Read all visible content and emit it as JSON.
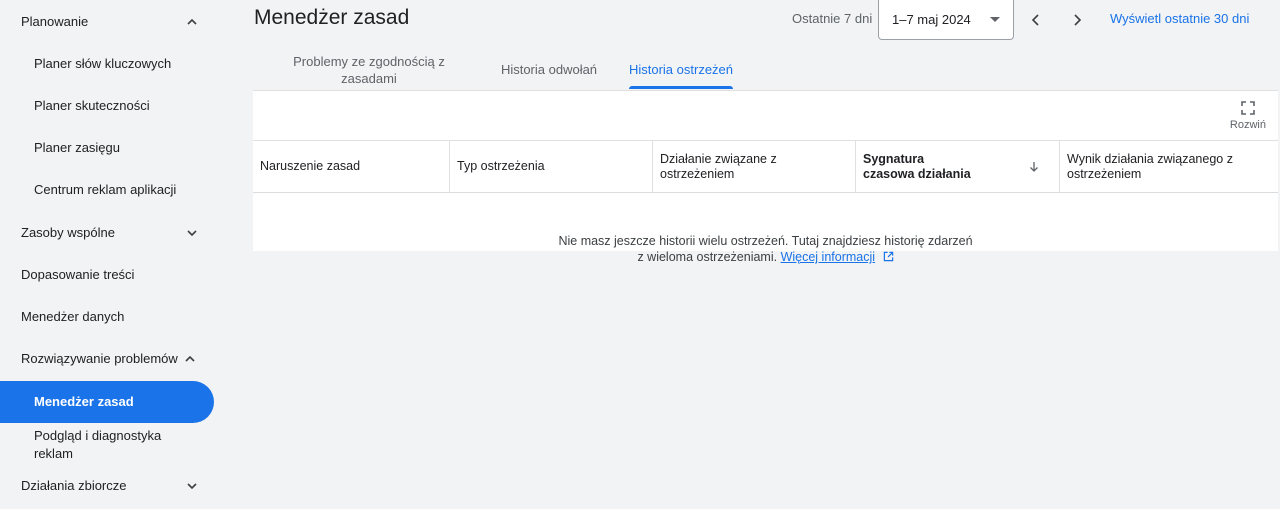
{
  "sidebar": {
    "planning": {
      "label": "Planowanie"
    },
    "keyword_planner": {
      "label": "Planer słów kluczowych"
    },
    "performance_planner": {
      "label": "Planer skuteczności"
    },
    "reach_planner": {
      "label": "Planer zasięgu"
    },
    "app_ads_hub": {
      "label": "Centrum reklam aplikacji"
    },
    "shared_library": {
      "label": "Zasoby wspólne"
    },
    "content_suitability": {
      "label": "Dopasowanie treści"
    },
    "data_manager": {
      "label": "Menedżer danych"
    },
    "troubleshooting": {
      "label": "Rozwiązywanie problemów"
    },
    "policy_manager": {
      "label": "Menedżer zasad"
    },
    "ad_preview": {
      "label": "Podgląd i diagnostyka reklam"
    },
    "bulk_actions": {
      "label": "Działania zbiorcze"
    }
  },
  "header": {
    "title": "Menedżer zasad",
    "range_caption": "Ostatnie 7 dni",
    "range_value": "1–7 maj 2024",
    "view_last_30": "Wyświetl ostatnie 30 dni"
  },
  "tabs": {
    "compliance": "Problemy ze zgodnością z zasadami",
    "appeals": "Historia odwołań",
    "strikes": "Historia ostrzeżeń"
  },
  "table": {
    "expand_label": "Rozwiń",
    "columns": [
      "Naruszenie zasad",
      "Typ ostrzeżenia",
      "Działanie związane z ostrzeżeniem",
      "Sygnatura czasowa działania",
      "Wynik działania związanego z ostrzeżeniem"
    ],
    "empty_line1": "Nie masz jeszcze historii wielu ostrzeżeń. Tutaj znajdziesz historię zdarzeń",
    "empty_line2": "z wieloma ostrzeżeniami.",
    "learn_more": "Więcej informacji"
  },
  "colors": {
    "accent": "#1a73e8",
    "background": "#f1f3f4"
  }
}
